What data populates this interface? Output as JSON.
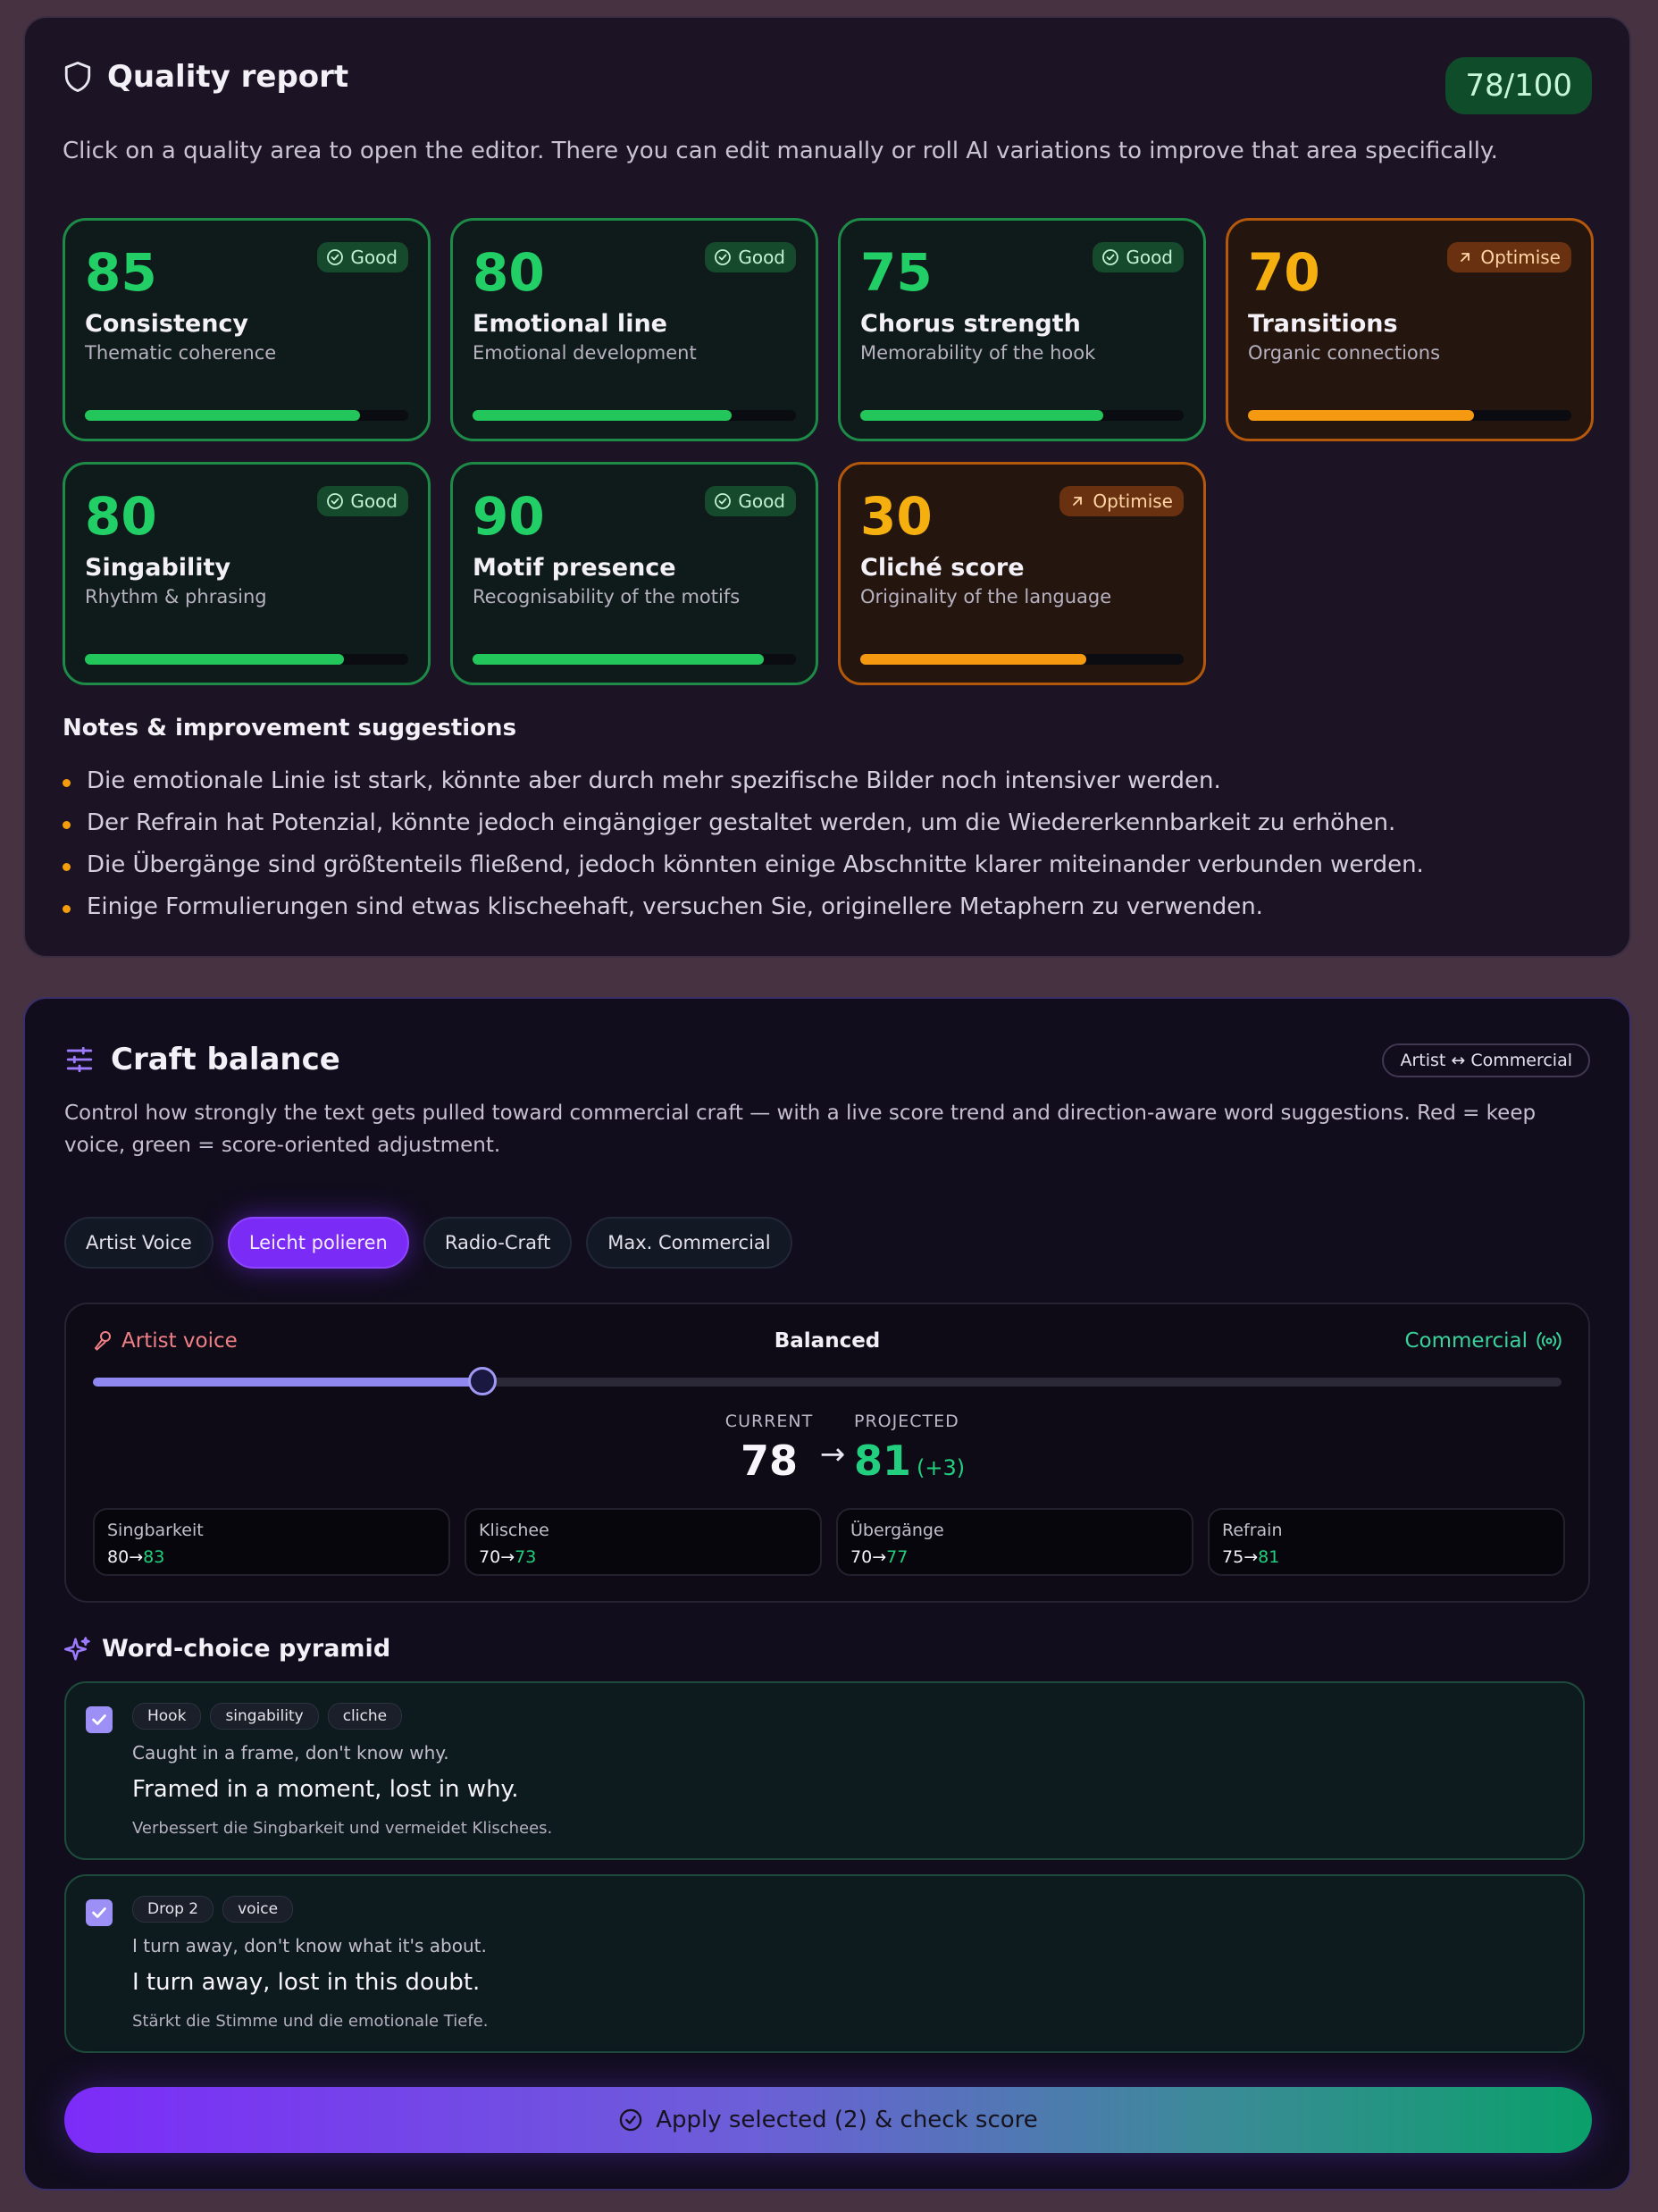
{
  "quality": {
    "title": "Quality report",
    "total_score": "78/100",
    "description": "Click on a quality area to open the editor. There you can edit manually or roll AI variations to improve that area specifically.",
    "cards": [
      {
        "score": "85",
        "name": "Consistency",
        "sub": "Thematic coherence",
        "status": "Good",
        "level": 0.85
      },
      {
        "score": "80",
        "name": "Emotional line",
        "sub": "Emotional development",
        "status": "Good",
        "level": 0.8
      },
      {
        "score": "75",
        "name": "Chorus strength",
        "sub": "Memorability of the hook",
        "status": "Good",
        "level": 0.75
      },
      {
        "score": "70",
        "name": "Transitions",
        "sub": "Organic connections",
        "status": "Optimise",
        "level": 0.7
      },
      {
        "score": "80",
        "name": "Singability",
        "sub": "Rhythm & phrasing",
        "status": "Good",
        "level": 0.8
      },
      {
        "score": "90",
        "name": "Motif presence",
        "sub": "Recognisability of the motifs",
        "status": "Good",
        "level": 0.9
      },
      {
        "score": "30",
        "name": "Cliché score",
        "sub": "Originality of the language",
        "status": "Optimise",
        "level": 0.7
      }
    ],
    "notes_title": "Notes & improvement suggestions",
    "notes": [
      "Die emotionale Linie ist stark, könnte aber durch mehr spezifische Bilder noch intensiver werden.",
      "Der Refrain hat Potenzial, könnte jedoch eingängiger gestaltet werden, um die Wiedererkennbarkeit zu erhöhen.",
      "Die Übergänge sind größtenteils fließend, jedoch könnten einige Abschnitte klarer miteinander verbunden werden.",
      "Einige Formulierungen sind etwas klischeehaft, versuchen Sie, originellere Metaphern zu verwenden."
    ]
  },
  "craft": {
    "title": "Craft balance",
    "mode_chip": "Artist ↔ Commercial",
    "description": "Control how strongly the text gets pulled toward commercial craft — with a live score trend and direction-aware word suggestions. Red = keep voice, green = score-oriented adjustment.",
    "presets": [
      {
        "label": "Artist Voice",
        "active": false
      },
      {
        "label": "Leicht polieren",
        "active": true
      },
      {
        "label": "Radio-Craft",
        "active": false
      },
      {
        "label": "Max. Commercial",
        "active": false
      }
    ],
    "slider": {
      "left_label": "Artist voice",
      "center_label": "Balanced",
      "right_label": "Commercial",
      "value": 0.265
    },
    "current_label": "CURRENT",
    "current_value": "78",
    "arrow": "→",
    "projected_label": "PROJECTED",
    "projected_value": "81",
    "projected_delta": "(+3)",
    "metrics": [
      {
        "name": "Singbarkeit",
        "from": "80",
        "to": "83"
      },
      {
        "name": "Klischee",
        "from": "70",
        "to": "73"
      },
      {
        "name": "Übergänge",
        "from": "70",
        "to": "77"
      },
      {
        "name": "Refrain",
        "from": "75",
        "to": "81"
      }
    ],
    "metric_arrow": "→",
    "pyramid_title": "Word-choice pyramid",
    "suggestions": [
      {
        "checked": true,
        "tags": [
          "Hook",
          "singability",
          "cliche"
        ],
        "original": "Caught in a frame, don't know why.",
        "suggestion": "Framed in a moment, lost in why.",
        "reason": "Verbessert die Singbarkeit und vermeidet Klischees."
      },
      {
        "checked": true,
        "tags": [
          "Drop 2",
          "voice"
        ],
        "original": "I turn away, don't know what it's about.",
        "suggestion": "I turn away, lost in this doubt.",
        "reason": "Stärkt die Stimme und die emotionale Tiefe."
      }
    ],
    "apply_label": "Apply selected (2) & check score"
  },
  "colors": {
    "good": "#22c65a",
    "optimise": "#f59a10",
    "accent": "#7a2bf5",
    "commercial": "#22cf7f",
    "artist": "#f07f86"
  }
}
